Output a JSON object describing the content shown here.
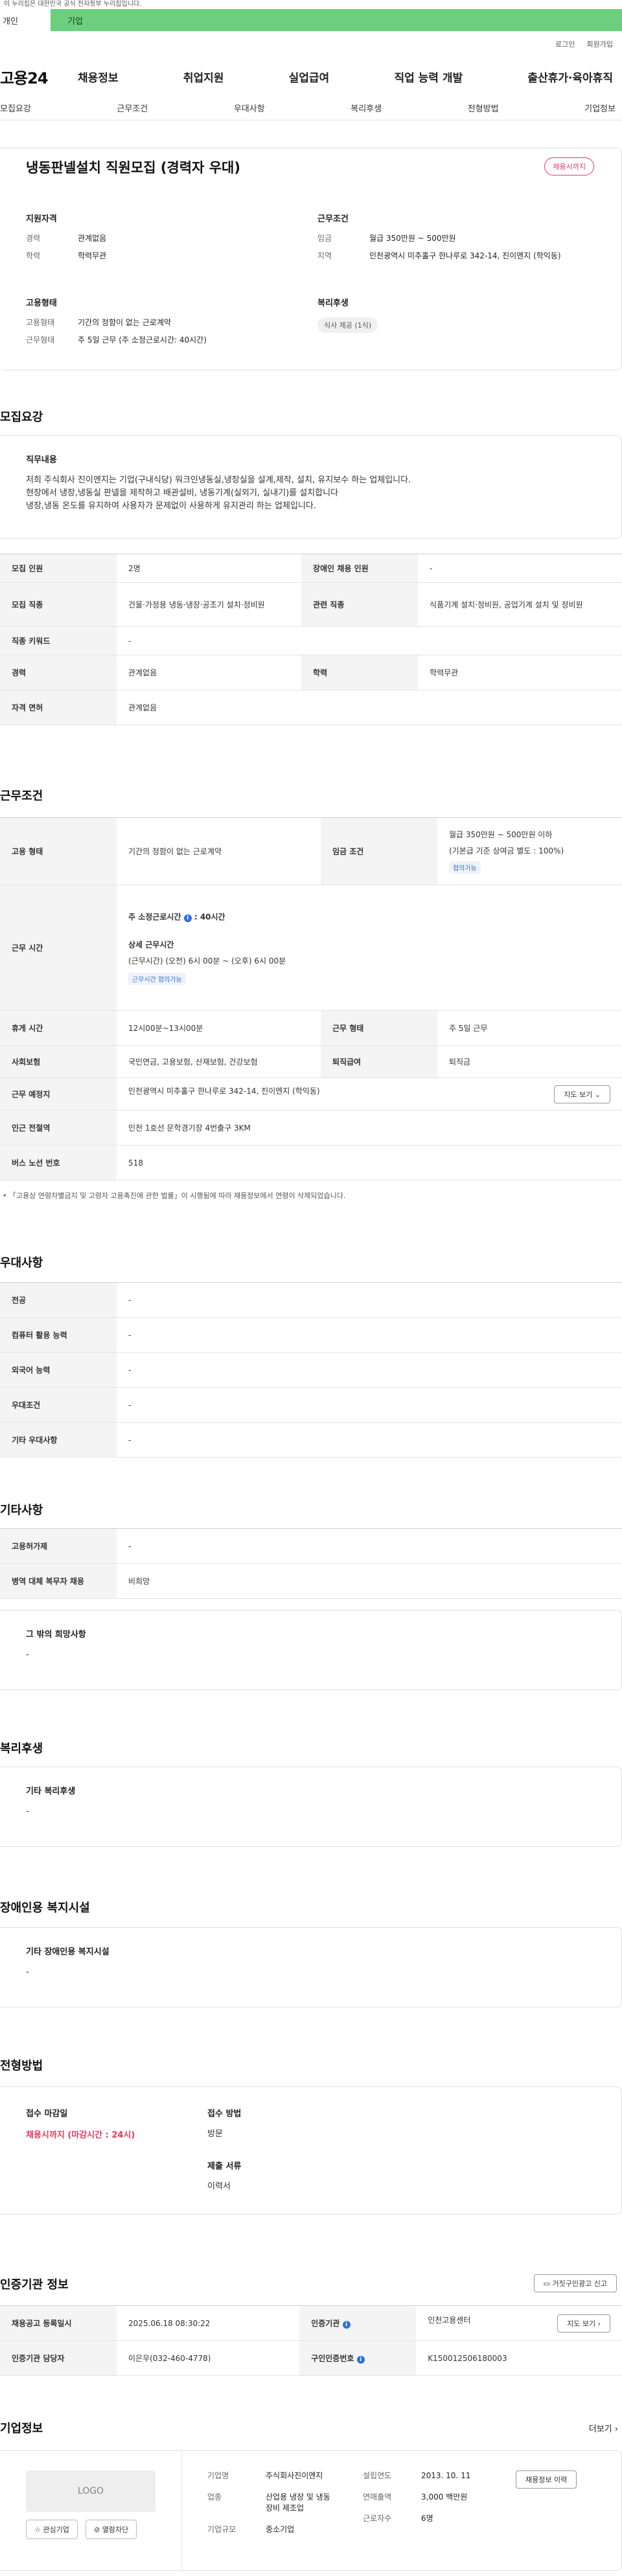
{
  "notice": "이 누리집은 대한민국 공식 전자정부 누리집입니다.",
  "topTabs": [
    "개인",
    "기업"
  ],
  "util": [
    "로그인",
    "회원가입"
  ],
  "gnb": {
    "logo": "고용24",
    "items": [
      "채용정보",
      "취업지원",
      "실업급여",
      "직업 능력 개발",
      "출산휴가·육아휴직"
    ]
  },
  "anchors": [
    "모집요강",
    "근무조건",
    "우대사항",
    "복리후생",
    "전형방법",
    "기업정보"
  ],
  "summary": {
    "title": "냉동판넬설치 직원모집 (경력자 우대)",
    "badge": "채용시까지",
    "qual": {
      "heading": "지원자격",
      "rows": [
        {
          "k": "경력",
          "v": "관계없음"
        },
        {
          "k": "학력",
          "v": "학력무관"
        }
      ]
    },
    "cond": {
      "heading": "근무조건",
      "rows": [
        {
          "k": "임금",
          "v": "월급 350만원 ~ 500만원"
        },
        {
          "k": "지역",
          "v": "인천광역시 미추홀구 한나루로 342-14, 진이엔지 (학익동)"
        }
      ]
    },
    "emp": {
      "heading": "고용형태",
      "rows": [
        {
          "k": "고용형태",
          "v": "기간의 정함이 없는 근로계약"
        },
        {
          "k": "근무형태",
          "v": "주 5일 근무 (주 소정근로시간: 40시간)"
        }
      ]
    },
    "welfare": {
      "heading": "복리후생",
      "chip": "식사 제공 (1식)"
    }
  },
  "recruit": {
    "title": "모집요강",
    "duty": {
      "heading": "직무내용",
      "lines": [
        "저희 주식회사 진이엔지는 기업(구내식당) 워크인냉동실,냉장실을 설계,제작, 설치, 유지보수 하는 업체입니다.",
        "현장에서 냉장,냉동실 판넬을 제작하고 배관설비, 냉동기계(실외기, 실내기)를 설치합니다",
        "냉장,냉동 온도를 유지하여 사용자가 문제없이 사용하게 유지관리 하는 업체입니다."
      ]
    },
    "table": [
      [
        {
          "k": "모집 인원",
          "v": "2명"
        },
        {
          "k": "장애인 채용 인원",
          "v": "-"
        }
      ],
      [
        {
          "k": "모집 직종",
          "v": "건물·가정용 냉동·냉장·공조기 설치·정비원"
        },
        {
          "k": "관련 직종",
          "v": "식품기계 설치·정비원, 공업기계 설치 및 정비원"
        }
      ],
      [
        {
          "k": "직종 키워드",
          "v": "-"
        }
      ],
      [
        {
          "k": "경력",
          "v": "관계없음"
        },
        {
          "k": "학력",
          "v": "학력무관"
        }
      ],
      [
        {
          "k": "자격 면허",
          "v": "관계없음"
        }
      ]
    ]
  },
  "work": {
    "title": "근무조건",
    "emp_type": {
      "k": "고용 형태",
      "v": "기간의 정함이 없는 근로계약"
    },
    "wage": {
      "k": "임금 조건",
      "v1": "월급 350만원 ~ 500만원 이하",
      "v2": "(기본급 기준 상여금 별도 : 100%)",
      "tag": "협의가능"
    },
    "hours": {
      "k": "근무 시간",
      "weekly": "주 소정근로시간",
      "weekly_val": ": 40시간",
      "detail_h": "상세 근무시간",
      "detail": "(근무시간) (오전) 6시 00분 ~ (오후) 6시 00분",
      "tag": "근무시간 협의가능"
    },
    "rest": [
      {
        "k": "휴게 시간",
        "v": "12시00분~13시00분"
      },
      {
        "k": "근무 형태",
        "v": "주 5일 근무"
      }
    ],
    "insurance": [
      {
        "k": "사회보험",
        "v": "국민연금, 고용보험, 산재보험, 건강보험"
      },
      {
        "k": "퇴직급여",
        "v": "퇴직금"
      }
    ],
    "location": {
      "k": "근무 예정지",
      "v": "인천광역시 미추홀구 한나루로 342-14, 진이엔지 (학익동)",
      "btn": "지도 보기"
    },
    "subway": {
      "k": "인근 전철역",
      "v": "인천 1호선 문학경기장 4번출구 3KM"
    },
    "bus": {
      "k": "버스 노선 번호",
      "v": "518"
    },
    "note": "「고용상 연령차별금지 및 고령자 고용촉진에 관한 법률」이 시행됨에 따라 채용정보에서 연령이 삭제되었습니다."
  },
  "pref": {
    "title": "우대사항",
    "rows": [
      {
        "k": "전공",
        "v": "-"
      },
      {
        "k": "컴퓨터 활용 능력",
        "v": "-"
      },
      {
        "k": "외국어 능력",
        "v": "-"
      },
      {
        "k": "우대조건",
        "v": "-"
      },
      {
        "k": "기타 우대사항",
        "v": "-"
      }
    ]
  },
  "etc": {
    "title": "기타사항",
    "rows": [
      {
        "k": "고용허가제",
        "v": "-"
      },
      {
        "k": "병역 대체 복무자 채용",
        "v": "비희망"
      }
    ],
    "box_h": "그 밖의 희망사항",
    "box_v": "-"
  },
  "welfare": {
    "title": "복리후생",
    "box_h": "기타 복리후생",
    "box_v": "-"
  },
  "disabled": {
    "title": "장애인용 복지시설",
    "box_h": "기타 장애인용 복지시설",
    "box_v": "-"
  },
  "process": {
    "title": "전형방법",
    "deadline_h": "접수 마감일",
    "deadline_v": "채용시까지 (마감시간 : 24시)",
    "method_h": "접수 방법",
    "method_v": "방문",
    "docs_h": "제출 서류",
    "docs_v": "이력서"
  },
  "agency": {
    "title": "인증기관 정보",
    "report_btn": "거짓구인광고 신고",
    "rows": [
      [
        {
          "k": "채용공고 등록일시",
          "v": "2025.06.18 08:30:22"
        },
        {
          "k": "인증기관",
          "v": "인천고용센터",
          "btn": "지도 보기"
        }
      ],
      [
        {
          "k": "인증기관 담당자",
          "v": "이은우(032-460-4778)"
        },
        {
          "k": "구인인증번호",
          "v": "K150012506180003"
        }
      ]
    ]
  },
  "company": {
    "title": "기업정보",
    "more": "더보기",
    "logo": "LOGO",
    "btn1": "관심기업",
    "btn2": "열람차단",
    "c1": [
      {
        "k": "기업명",
        "v": "주식회사진이엔지"
      },
      {
        "k": "업종",
        "v": "산업용 냉장 및 냉동 장비 제조업"
      },
      {
        "k": "기업규모",
        "v": "중소기업"
      }
    ],
    "c2": [
      {
        "k": "설립연도",
        "v": "2013. 10. 11"
      },
      {
        "k": "연매출액",
        "v": "3,000 백만원"
      },
      {
        "k": "근로자수",
        "v": "6명"
      }
    ],
    "history_btn": "채용정보 이력"
  }
}
